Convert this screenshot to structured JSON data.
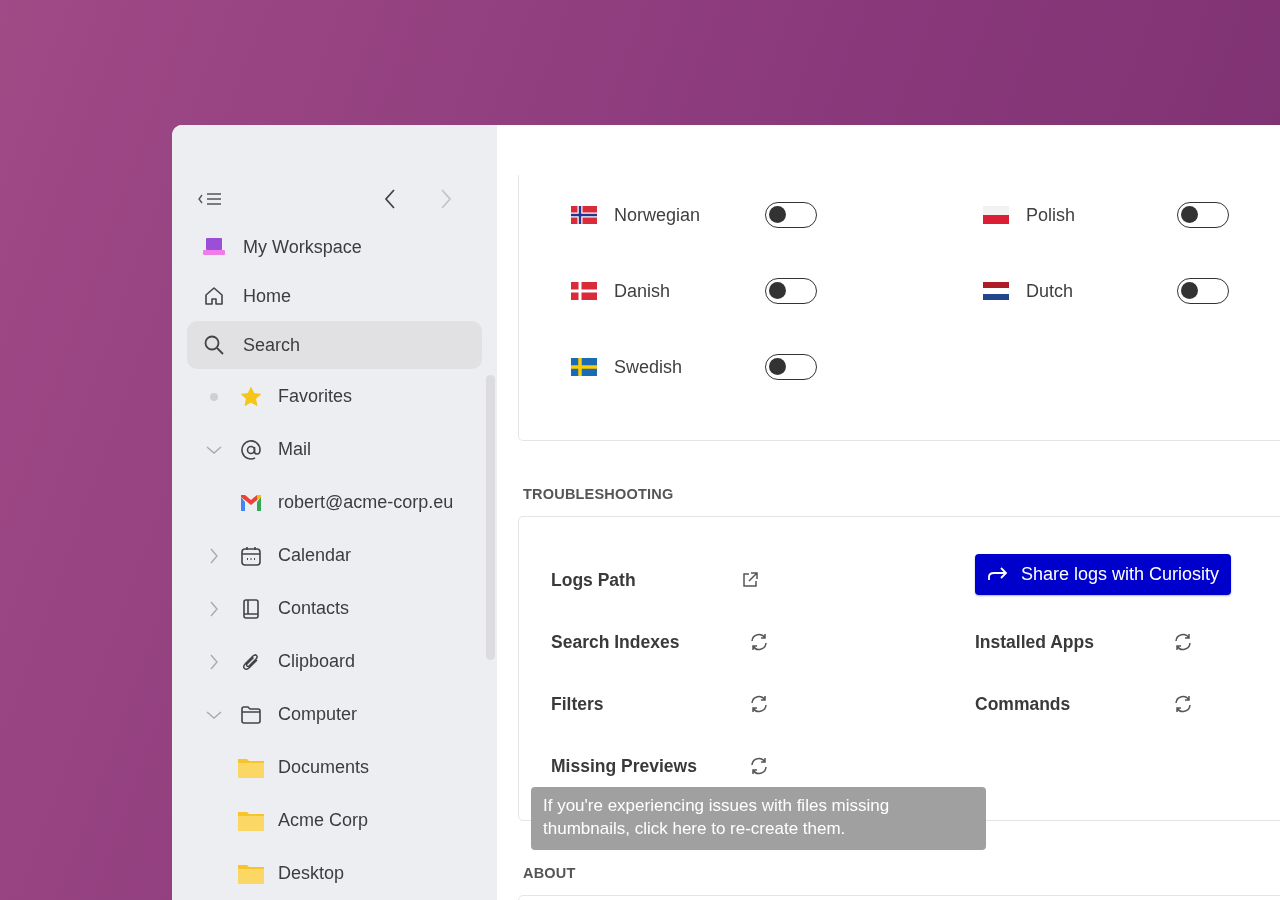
{
  "sidebar": {
    "nav": [
      {
        "label": "My Workspace",
        "kind": "workspace",
        "selected": false
      },
      {
        "label": "Home",
        "kind": "home",
        "selected": false
      },
      {
        "label": "Search",
        "kind": "search",
        "selected": true
      }
    ],
    "tree": [
      {
        "label": "Favorites",
        "kind": "star"
      },
      {
        "label": "Mail",
        "kind": "at",
        "expanded": true,
        "children": [
          {
            "label": "robert@acme-corp.eu",
            "kind": "gmail"
          }
        ]
      },
      {
        "label": "Calendar",
        "kind": "calendar",
        "expanded": false
      },
      {
        "label": "Contacts",
        "kind": "book",
        "expanded": false
      },
      {
        "label": "Clipboard",
        "kind": "clip",
        "expanded": false
      },
      {
        "label": "Computer",
        "kind": "drive",
        "expanded": true,
        "children": [
          {
            "label": "Documents",
            "kind": "folder"
          },
          {
            "label": "Acme Corp",
            "kind": "folder"
          },
          {
            "label": "Desktop",
            "kind": "folder"
          }
        ]
      }
    ]
  },
  "languages": [
    {
      "label": "Norwegian",
      "kind": "norway",
      "on": false
    },
    {
      "label": "Polish",
      "kind": "poland",
      "on": false
    },
    {
      "label": "Danish",
      "kind": "denmark",
      "on": false
    },
    {
      "label": "Dutch",
      "kind": "netherlands",
      "on": false
    },
    {
      "label": "Swedish",
      "kind": "sweden",
      "on": false
    }
  ],
  "troubleshooting": {
    "title": "TROUBLESHOOTING",
    "rows": [
      {
        "cells": [
          {
            "kind": "link",
            "label": "Logs Path"
          },
          {
            "kind": "button",
            "label": "Share logs with Curiosity"
          }
        ]
      },
      {
        "cells": [
          {
            "kind": "refresh",
            "label": "Search Indexes"
          },
          {
            "kind": "refresh",
            "label": "Installed Apps"
          }
        ]
      },
      {
        "cells": [
          {
            "kind": "refresh",
            "label": "Filters"
          },
          {
            "kind": "refresh",
            "label": "Commands"
          }
        ]
      },
      {
        "cells": [
          {
            "kind": "refresh",
            "label": "Missing Previews"
          }
        ]
      }
    ],
    "tooltip": "If you're experiencing issues with files missing thumbnails, click here to re-create them."
  },
  "about": {
    "title": "ABOUT"
  }
}
